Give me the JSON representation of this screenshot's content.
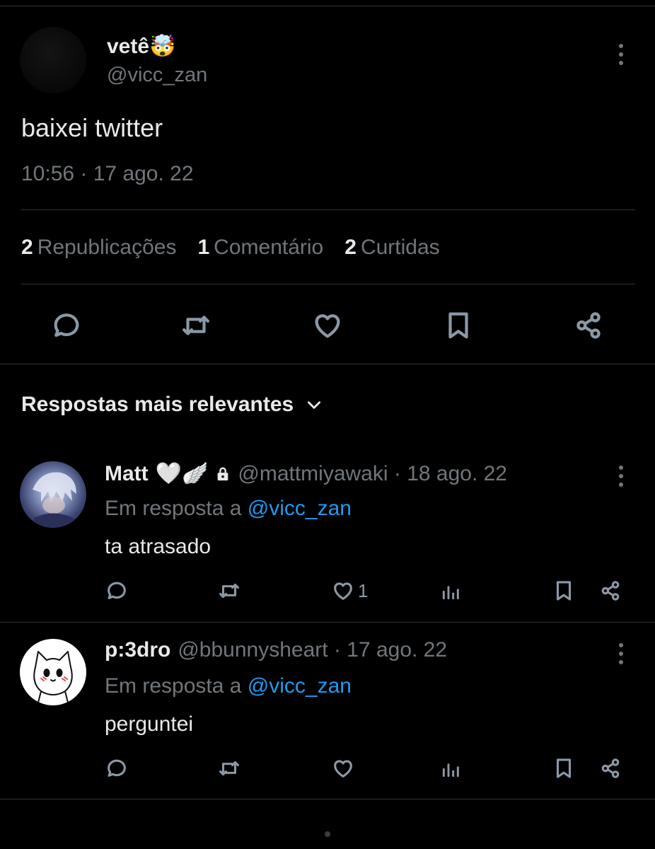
{
  "tweet": {
    "name": "vetê🤯",
    "handle": "@vicc_zan",
    "text": "baixei twitter",
    "time": "10:56 · 17 ago. 22"
  },
  "stats": [
    {
      "count": "2",
      "label": "Republicações"
    },
    {
      "count": "1",
      "label": "Comentário"
    },
    {
      "count": "2",
      "label": "Curtidas"
    }
  ],
  "actions": [
    "reply-icon",
    "retweet-icon",
    "like-icon",
    "bookmark-icon",
    "share-icon"
  ],
  "replies_section": {
    "title": "Respostas mais relevantes"
  },
  "replies": [
    {
      "name": "Matt",
      "emoji": "🤍🪽",
      "handle": "@mattmiyawaki · 18 ago. 22",
      "reply_prefix": "Em resposta a",
      "mention": "@vicc_zan",
      "text": "ta atrasado",
      "like_count": "1"
    },
    {
      "name": "p:3dro",
      "handle": "@bbunnysheart · 17 ago. 22",
      "reply_prefix": "Em resposta a",
      "mention": "@vicc_zan",
      "text": "perguntei",
      "like_count": ""
    }
  ],
  "colors": {
    "background": "#000000",
    "text": "#e7e9ea",
    "secondary": "#71767b",
    "divider": "#2f3336",
    "link": "#1d9bf0"
  }
}
